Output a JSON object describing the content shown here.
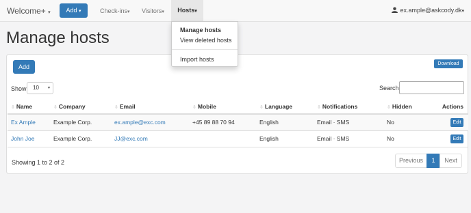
{
  "navbar": {
    "brand": "Welcome+",
    "add_label": "Add",
    "links": [
      "Check-ins",
      "Visitors"
    ],
    "active": "Hosts",
    "user": "ex.ample@askcody.dk"
  },
  "page_title": "Manage hosts",
  "toolbar": {
    "add_label": "Add",
    "download_label": "Download",
    "show_label": "Show",
    "show_value": "10",
    "search_label": "Search:",
    "search_value": ""
  },
  "table": {
    "columns": [
      "Name",
      "Company",
      "Email",
      "Mobile",
      "Language",
      "Notifications",
      "Hidden",
      "Actions"
    ],
    "rows": [
      {
        "name": "Ex Ample",
        "company": "Example Corp.",
        "email": "ex.ample@exc.com",
        "mobile": "+45 89 88 70 94",
        "language": "English",
        "notifications": "Email · SMS",
        "hidden": "No",
        "action": "Edit"
      },
      {
        "name": "John Joe",
        "company": "Example Corp.",
        "email": "JJ@exc.com",
        "mobile": "",
        "language": "English",
        "notifications": "Email · SMS",
        "hidden": "No",
        "action": "Edit"
      }
    ]
  },
  "footer": {
    "info": "Showing 1 to 2 of 2",
    "prev": "Previous",
    "current_page": "1",
    "next": "Next"
  },
  "dropdown": {
    "items": [
      "Manage hosts",
      "View deleted hosts",
      "Import hosts"
    ]
  },
  "colors": {
    "primary": "#337ab7",
    "navbar_bg": "#f8f8f8",
    "active_nav_bg": "#e7e7e7"
  }
}
